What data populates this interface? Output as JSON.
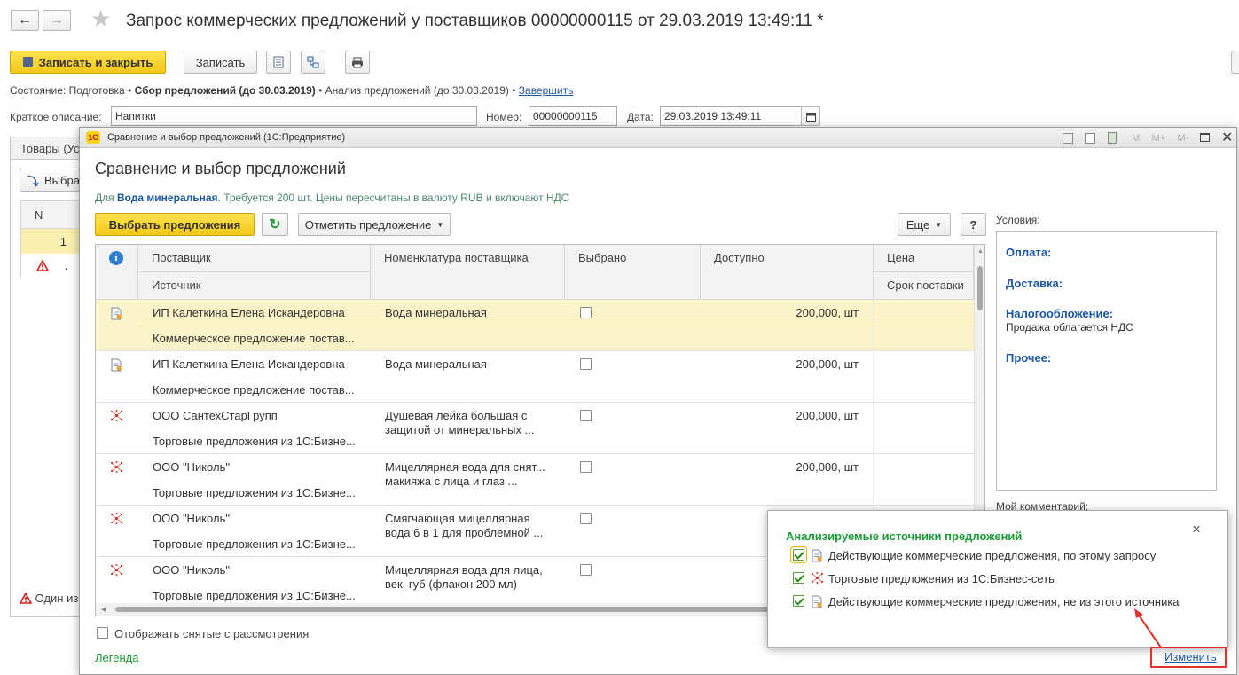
{
  "window": {
    "title": "Запрос коммерческих предложений у поставщиков 00000000115 от 29.03.2019 13:49:11 *"
  },
  "toolbar": {
    "save_close_label": "Записать и закрыть",
    "save_label": "Записать"
  },
  "status": {
    "label": "Состояние:",
    "step1": "Подготовка",
    "sep": "•",
    "step2": "Сбор предложений (до 30.03.2019)",
    "step3": "Анализ предложений (до 30.03.2019)",
    "finish_link": "Завершить"
  },
  "header_fields": {
    "desc_label": "Краткое описание:",
    "desc_value": "Напитки",
    "number_label": "Номер:",
    "number_value": "00000000115",
    "date_label": "Дата:",
    "date_value": "29.03.2019 13:49:11"
  },
  "background_form": {
    "tab_label": "Товары (Ус",
    "select_btn": "Выбра",
    "col_n": "N",
    "row1_n": "1",
    "row2_n": ".",
    "warning_text": "Один из"
  },
  "dialog": {
    "window_title": "Сравнение и выбор предложений  (1С:Предприятие)",
    "title_btns": [
      "M",
      "M+",
      "M-"
    ],
    "heading": "Сравнение и выбор предложений",
    "info_prefix": "Для ",
    "info_item": "Вода минеральная",
    "info_suffix": ". Требуется 200 шт. Цены пересчитаны в валюту RUB и включают НДС",
    "select_offers_btn": "Выбрать предложения",
    "mark_offer_btn": "Отметить предложение",
    "more_btn": "Еще",
    "help_btn": "?",
    "conditions_label": "Условия:",
    "conditions": {
      "payment": "Оплата:",
      "delivery": "Доставка:",
      "tax_label": "Налогообложение:",
      "tax_value": "Продажа облагается НДС",
      "other": "Прочее:"
    },
    "my_comment_label": "Мой комментарий:",
    "show_removed_label": "Отображать снятые с рассмотрения",
    "legend_link": "Легенда",
    "columns": {
      "supplier": "Поставщик",
      "source": "Источник",
      "nomenclature": "Номенклатура поставщика",
      "selected": "Выбрано",
      "available": "Доступно",
      "price": "Цена",
      "delivery_term": "Срок поставки"
    },
    "rows": [
      {
        "supplier": "ИП Калеткина Елена Искандеровна",
        "source": "Коммерческое предложение постав...",
        "nom1": "Вода минеральная",
        "nom2": "",
        "available": "200,000, шт",
        "icon": "document-offer-icon"
      },
      {
        "supplier": "ИП Калеткина Елена Искандеровна",
        "source": "Коммерческое предложение постав...",
        "nom1": "Вода минеральная",
        "nom2": "",
        "available": "200,000, шт",
        "icon": "document-offer-icon"
      },
      {
        "supplier": "ООО СантехСтарГрупп",
        "source": "Торговые предложения из 1С:Бизне...",
        "nom1": "Душевая лейка большая с",
        "nom2": "защитой от минеральных ...",
        "available": "200,000, шт",
        "icon": "business-network-icon"
      },
      {
        "supplier": "ООО \"Николь\"",
        "source": "Торговые предложения из 1С:Бизне...",
        "nom1": "Мицеллярная вода для снят...",
        "nom2": "макияжа с лица и глаз ...",
        "available": "200,000, шт",
        "icon": "business-network-icon"
      },
      {
        "supplier": "ООО \"Николь\"",
        "source": "Торговые предложения из 1С:Бизне...",
        "nom1": "Смягчающая мицеллярная",
        "nom2": "вода 6 в 1 для проблемной ...",
        "available": "",
        "icon": "business-network-icon"
      },
      {
        "supplier": "ООО \"Николь\"",
        "source": "Торговые предложения из 1С:Бизне...",
        "nom1": "Мицеллярная вода для лица,",
        "nom2": "век, губ (флакон 200 мл)",
        "available": "",
        "icon": "business-network-icon"
      }
    ]
  },
  "popup": {
    "title": "Анализируемые источники предложений",
    "close": "×",
    "options": [
      {
        "label": "Действующие коммерческие предложения, по этому запросу",
        "icon": "document-offer-icon"
      },
      {
        "label": "Торговые предложения из 1С:Бизнес-сеть",
        "icon": "business-network-icon"
      },
      {
        "label": "Действующие коммерческие предложения, не из этого источника",
        "icon": "document-offer-icon"
      }
    ],
    "change_link": "Изменить"
  },
  "colors": {
    "accent_yellow": "#f5cc1f",
    "link_blue": "#1c58a6",
    "green": "#1a9c34",
    "highlight": "#e0332b",
    "selected_row": "#fbf4c8"
  }
}
